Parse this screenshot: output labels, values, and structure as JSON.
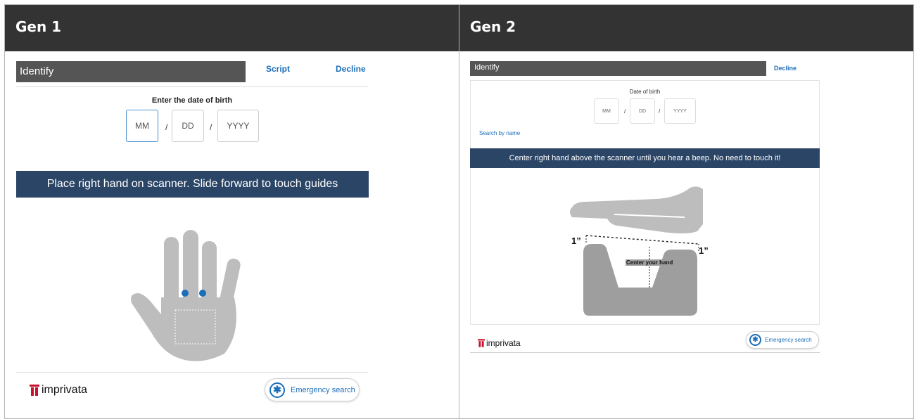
{
  "gen1": {
    "header": "Gen 1",
    "title": "Identify",
    "script_link": "Script",
    "decline_link": "Decline",
    "dob_label": "Enter the date of birth",
    "dob_fields": {
      "month": "MM",
      "day": "DD",
      "year": "YYYY"
    },
    "separator": "/",
    "instruction": "Place right hand on scanner. Slide forward to touch guides",
    "logo_text": "imprivata",
    "emergency_label": "Emergency search"
  },
  "gen2": {
    "header": "Gen 2",
    "title": "Identify",
    "decline_link": "Decline",
    "dob_label": "Date of birth",
    "dob_fields": {
      "month": "MM",
      "day": "DD",
      "year": "YYYY"
    },
    "separator": "/",
    "search_by_name": "Search by name",
    "instruction": "Center right hand above the scanner until you hear a beep. No need to touch it!",
    "distance_left": "1”",
    "distance_right": "1”",
    "center_label": "Center your hand",
    "logo_text": "imprivata",
    "emergency_label": "Emergency search"
  },
  "colors": {
    "header_bg": "#333333",
    "title_bar": "#555555",
    "banner": "#2b4566",
    "link": "#1c6eb8",
    "brand_red": "#c8102e",
    "hand_gray": "#bdbdbd",
    "scanner_gray": "#9e9e9e"
  },
  "icons": [
    "imprivata-logo-icon",
    "emergency-asterisk-icon",
    "hand-placement-illustration",
    "scanner-illustration"
  ]
}
